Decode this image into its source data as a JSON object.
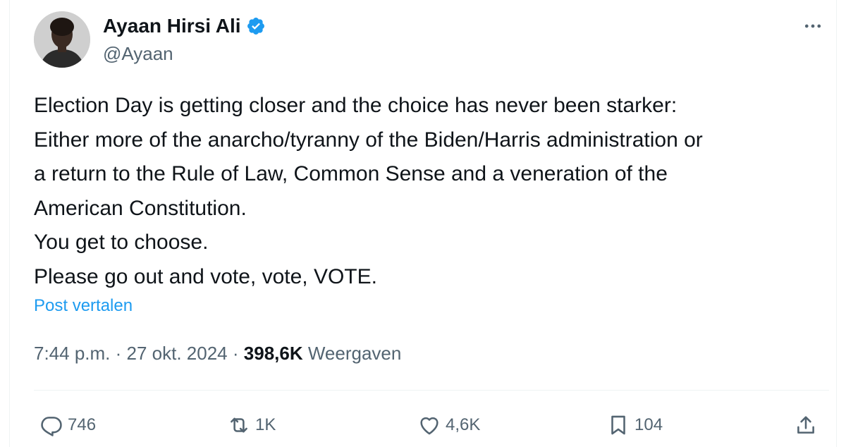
{
  "author": {
    "display_name": "Ayaan Hirsi Ali",
    "handle": "@Ayaan",
    "verified_icon": "verified-badge-icon",
    "avatar": "profile-photo"
  },
  "tweet": {
    "lines": [
      "Election Day is getting closer and the choice has never been starker:",
      "Either more of the anarcho/tyranny of the Biden/Harris administration or",
      "a return to the Rule of Law, Common Sense and a veneration of the",
      "American Constitution.",
      "You get to choose.",
      "Please go out and vote, vote, VOTE."
    ],
    "translate_label": "Post vertalen",
    "time": "7:44 p.m.",
    "date": "27 okt. 2024",
    "views_count": "398,6K",
    "views_label": "Weergaven"
  },
  "actions": {
    "replies": "746",
    "reposts": "1K",
    "likes": "4,6K",
    "bookmarks": "104"
  },
  "colors": {
    "accent": "#1d9bf0",
    "secondary_text": "#536471",
    "primary_text": "#0f1419"
  }
}
